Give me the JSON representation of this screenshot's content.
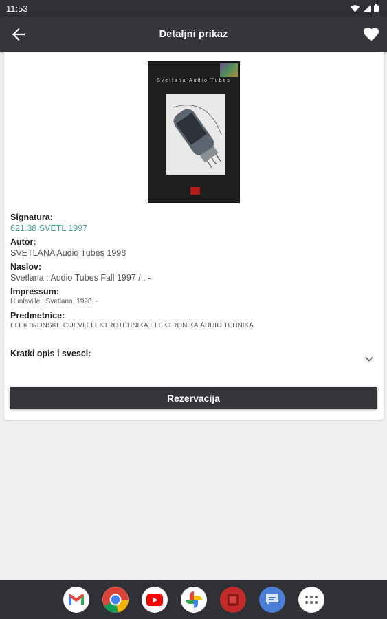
{
  "status_bar": {
    "time": "11:53"
  },
  "app_bar": {
    "title": "Detaljni prikaz"
  },
  "book": {
    "cover_title": "Svetlana Audio Tubes",
    "fields": [
      {
        "label": "Signatura:",
        "value": "621.38 SVETL 1997"
      },
      {
        "label": "Autor:",
        "value": "SVETLANA Audio Tubes 1998"
      },
      {
        "label": "Naslov:",
        "value": "Svetlana : Audio Tubes Fall 1997 / . -"
      },
      {
        "label": "Impressum:",
        "value": "Huntsville : Svetlana, 1998. -"
      },
      {
        "label": "Predmetnice:",
        "value": "ELEKTRONSKE CIJEVI,ELEKTROTEHNIKA,ELEKTRONIKA,AUDIO TEHNIKA"
      }
    ],
    "description_label": "Kratki opis i svesci:"
  },
  "actions": {
    "reserve_label": "Rezervacija"
  },
  "colors": {
    "accent_teal": "#3f9e8e",
    "bar_dark": "#35363b"
  },
  "dock": {
    "apps": [
      "gmail-icon",
      "chrome-icon",
      "youtube-icon",
      "photos-icon",
      "red-app-icon",
      "messages-icon",
      "app-drawer-icon"
    ]
  }
}
